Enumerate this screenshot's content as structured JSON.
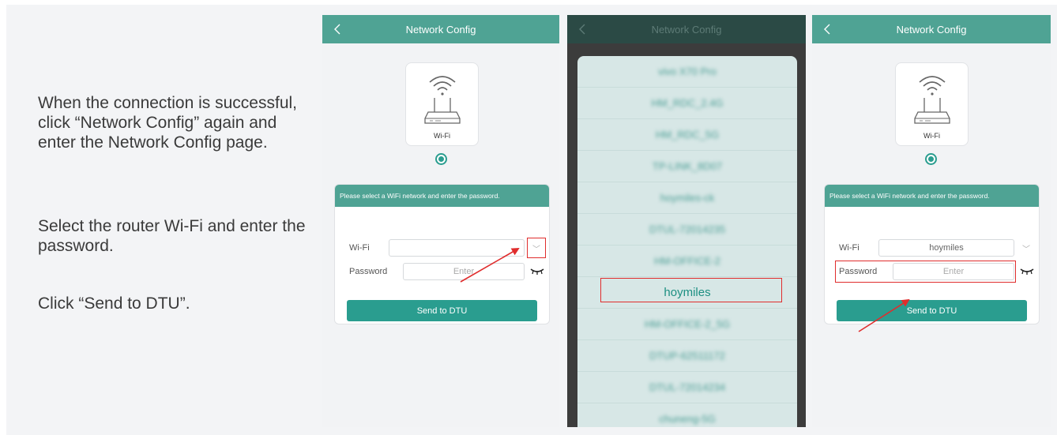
{
  "instructions": {
    "p1": "When the connection is successful, click “Network Config” again and enter the Network Config page.",
    "p2": "Select the router Wi-Fi and enter the password.",
    "p3": "Click “Send to DTU”."
  },
  "screen1": {
    "title": "Network Config",
    "wifi_card_label": "Wi-Fi",
    "hint": "Please select a WiFi network and enter the password.",
    "wifi_label": "Wi-Fi",
    "wifi_value": "",
    "password_label": "Password",
    "password_placeholder": "Enter",
    "send_label": "Send to DTU"
  },
  "screen2": {
    "title": "Network Config",
    "networks": [
      "vivo X70 Pro",
      "HM_RDC_2.4G",
      "HM_RDC_5G",
      "TP-LINK_8D07",
      "hoymiles-ck",
      "DTUL-72014235",
      "HM-OFFICE-2",
      "hoymiles",
      "HM-OFFICE-2_5G",
      "DTUP-62511172",
      "DTUL-72014234",
      "chuneng-5G"
    ],
    "selected_network": "hoymiles"
  },
  "screen3": {
    "title": "Network Config",
    "wifi_card_label": "Wi-Fi",
    "hint": "Please select a WiFi network and enter the password.",
    "wifi_label": "Wi-Fi",
    "wifi_value": "hoymiles",
    "password_label": "Password",
    "password_placeholder": "Enter",
    "send_label": "Send to DTU"
  },
  "colors": {
    "accent": "#4fa394",
    "button": "#2a9d8f",
    "highlight": "#e02d2d"
  }
}
